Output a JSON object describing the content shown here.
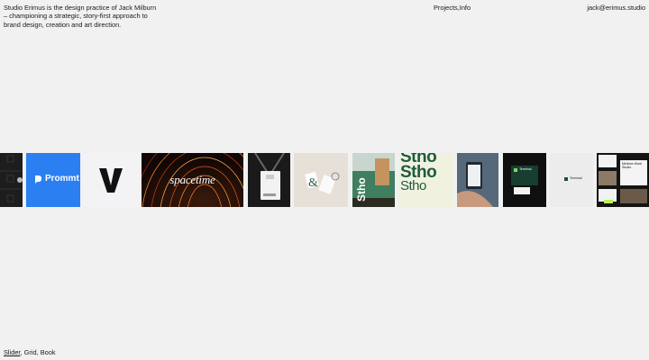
{
  "intro": "Studio Erimus is the design practice of Jack Milburn – championing a strategic, story-first approach to brand design, creation and art direction.",
  "nav": {
    "projects": "Projects",
    "sep": ",",
    "info": "Info"
  },
  "email": "jack@erimus.studio",
  "views": {
    "slider": "Slider",
    "sep1": ", ",
    "grid": "Grid",
    "sep2": ", ",
    "book": "Book"
  },
  "tiles": {
    "prommt": "Prommt",
    "spacetime": "spacetime",
    "stho": "Stho",
    "terminal": "Terminal",
    "medium": "Medium Work Studio"
  },
  "colors": {
    "background": "#f1f1f1",
    "text": "#1a1a1a",
    "prommt_blue": "#2b7ff1",
    "stho_green": "#1f5b3f"
  }
}
